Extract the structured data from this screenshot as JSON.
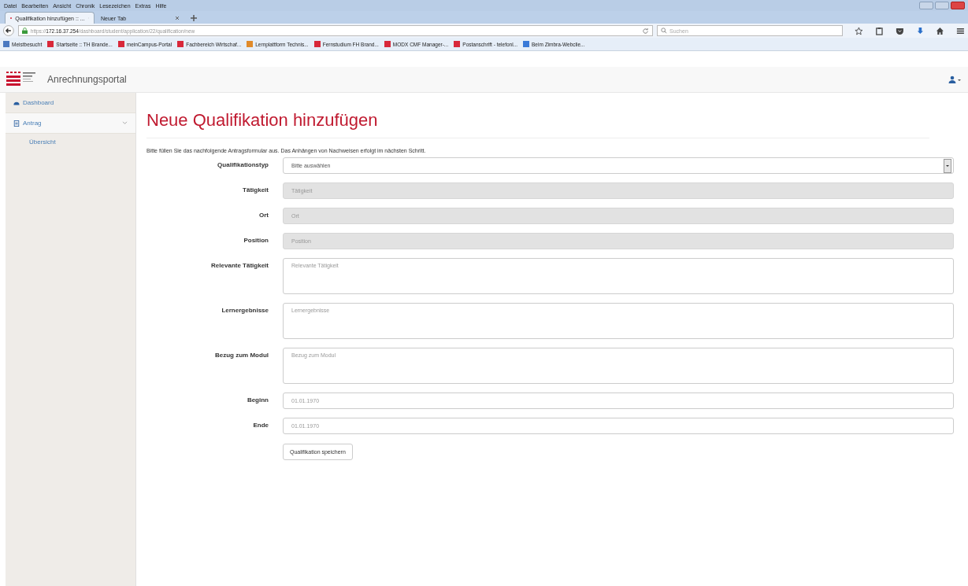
{
  "menu_bar": [
    "Datei",
    "Bearbeiten",
    "Ansicht",
    "Chronik",
    "Lesezeichen",
    "Extras",
    "Hilfe"
  ],
  "tabs": [
    {
      "label": "Qualifikation hinzufügen :: ...",
      "selected": true
    },
    {
      "label": "Neuer Tab",
      "selected": false
    }
  ],
  "address_bar": {
    "host": "https://172.16.37.254",
    "path": "/dashboard/student/application/22/qualification/new"
  },
  "search": {
    "placeholder": "Suchen"
  },
  "bookmarks": [
    {
      "label": "Meistbesucht",
      "color": "#4a78c0"
    },
    {
      "label": "Startseite :: TH Brande...",
      "color": "#d8283a"
    },
    {
      "label": "meinCampus-Portal",
      "color": "#d8283a"
    },
    {
      "label": "Fachbereich Wirtschaf...",
      "color": "#d8283a"
    },
    {
      "label": "Lernplattform Technis...",
      "color": "#e08a2a"
    },
    {
      "label": "Fernstudium FH Brand...",
      "color": "#d8283a"
    },
    {
      "label": "MODX CMF Manager-...",
      "color": "#d8283a"
    },
    {
      "label": "Postanschrift - telefonl...",
      "color": "#d8283a"
    },
    {
      "label": "Beim Zimbra-Webclie...",
      "color": "#3a7ad8"
    }
  ],
  "app": {
    "title": "Anrechnungsportal"
  },
  "sidebar": {
    "items": [
      {
        "label": "Dashboard",
        "kind": "dashboard",
        "selected": false
      },
      {
        "label": "Antrag",
        "kind": "document",
        "selected": true,
        "expanded": true,
        "children": [
          {
            "label": "Übersicht",
            "selected": false
          }
        ]
      }
    ]
  },
  "page": {
    "heading": "Neue Qualifikation hinzufügen",
    "intro": "Bitte füllen Sie das nachfolgende Antragsformular aus. Das Anhängen von Nachweisen erfolgt im nächsten Schritt.",
    "fields": [
      {
        "label": "Qualifikationstyp",
        "kind": "select",
        "value": "Bitte auswählen"
      },
      {
        "label": "Tätigkeit",
        "kind": "input",
        "placeholder": "Tätigkeit",
        "disabled": true
      },
      {
        "label": "Ort",
        "kind": "input",
        "placeholder": "Ort",
        "disabled": true
      },
      {
        "label": "Position",
        "kind": "input",
        "placeholder": "Position",
        "disabled": true
      },
      {
        "label": "Relevante Tätigkeit",
        "kind": "textarea",
        "placeholder": "Relevante Tätigkeit",
        "disabled": false
      },
      {
        "label": "Lernergebnisse",
        "kind": "textarea",
        "placeholder": "Lernergebnisse",
        "disabled": false
      },
      {
        "label": "Bezug zum Modul",
        "kind": "textarea",
        "placeholder": "Bezug zum Modul",
        "disabled": false
      },
      {
        "label": "Beginn",
        "kind": "input",
        "placeholder": "01.01.1970",
        "disabled": false
      },
      {
        "label": "Ende",
        "kind": "input",
        "placeholder": "01.01.1970",
        "disabled": false
      }
    ],
    "submit": "Qualifikation speichern"
  }
}
